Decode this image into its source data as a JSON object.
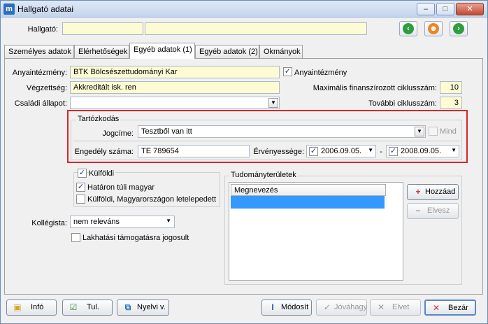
{
  "window": {
    "title": "Hallgató adatai",
    "app_icon_text": "m"
  },
  "header": {
    "label": "Hallgató:",
    "name_value": "",
    "code_value": ""
  },
  "tabs": [
    "Személyes adatok",
    "Elérhetőségek",
    "Egyéb adatok (1)",
    "Egyéb adatok (2)",
    "Okmányok"
  ],
  "active_tab": "Egyéb adatok (1)",
  "form": {
    "anyaintezmeny_label": "Anyaintézmény:",
    "anyaintezmeny_value": "BTK Bölcsészettudományi Kar",
    "anyaintezmeny_cb_label": "Anyaintézmény",
    "vegzettseg_label": "Végzettség:",
    "vegzettseg_value": "Akkreditált isk. ren",
    "csaladi_label": "Családi állapot:",
    "csaladi_value": "",
    "max_ciklus_label": "Maximális finanszírozott ciklusszám:",
    "max_ciklus_value": "10",
    "tovabbi_ciklus_label": "További ciklusszám:",
    "tovabbi_ciklus_value": "3"
  },
  "tartozkodas": {
    "title": "Tartózkodás",
    "jogcime_label": "Jogcíme:",
    "jogcime_value": "Tesztből van itt",
    "mind_label": "Mind",
    "engedely_label": "Engedély száma:",
    "engedely_value": "TE 789654",
    "ervenyesseg_label": "Érvényessége:",
    "date_from": "2006.09.05.",
    "separator": "-",
    "date_to": "2008.09.05."
  },
  "kulfoldi": {
    "label": "Külföldi",
    "hataron_tuli": "Határon túli magyar",
    "letelepedett": "Külföldi, Magyarországon letelepedett"
  },
  "kollegista": {
    "label": "Kollégista:",
    "value": "nem releváns"
  },
  "lakhatasi": "Lakhatási támogatásra jogosult",
  "tudomany": {
    "title": "Tudományterületek",
    "column": "Megnevezés",
    "add_button": "Hozzáad",
    "remove_button": "Elvesz"
  },
  "footer": {
    "info": "Infó",
    "tul": "Tul.",
    "nyelvi": "Nyelvi v.",
    "modosit": "Módosít",
    "jovahagy": "Jóváhagy",
    "elvet": "Elvet",
    "bezar": "Bezár"
  },
  "colors": {
    "required_field": "#fdfbd4",
    "highlight_border": "#d9262a",
    "selection": "#3399ff"
  }
}
